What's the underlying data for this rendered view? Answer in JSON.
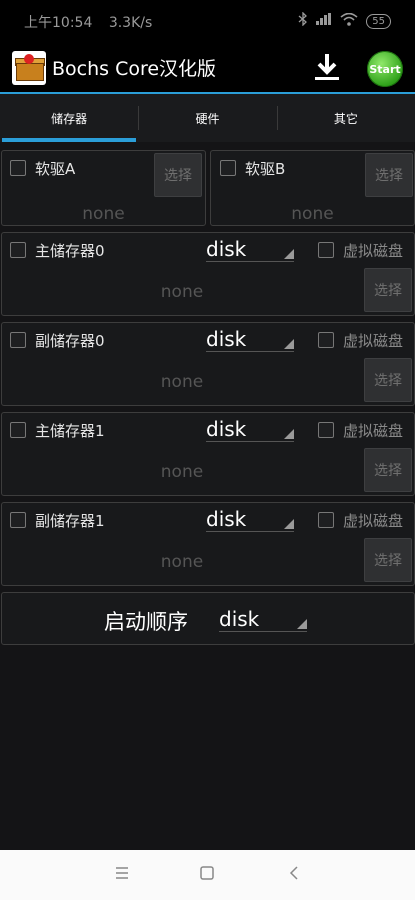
{
  "status": {
    "time": "上午10:54",
    "speed": "3.3K/s",
    "battery": "55"
  },
  "app": {
    "title": "Bochs Core汉化版",
    "start_label": "Start"
  },
  "tabs": [
    {
      "label": "储存器"
    },
    {
      "label": "硬件"
    },
    {
      "label": "其它"
    }
  ],
  "floppy": [
    {
      "label": "软驱A",
      "value": "none",
      "button": "选择"
    },
    {
      "label": "软驱B",
      "value": "none",
      "button": "选择"
    }
  ],
  "drives": [
    {
      "label": "主储存器0",
      "type": "disk",
      "virtual_label": "虚拟磁盘",
      "value": "none",
      "button": "选择"
    },
    {
      "label": "副储存器0",
      "type": "disk",
      "virtual_label": "虚拟磁盘",
      "value": "none",
      "button": "选择"
    },
    {
      "label": "主储存器1",
      "type": "disk",
      "virtual_label": "虚拟磁盘",
      "value": "none",
      "button": "选择"
    },
    {
      "label": "副储存器1",
      "type": "disk",
      "virtual_label": "虚拟磁盘",
      "value": "none",
      "button": "选择"
    }
  ],
  "boot": {
    "label": "启动顺序",
    "value": "disk"
  },
  "colors": {
    "accent": "#2b9ed8",
    "start_green": "#2fa11a"
  }
}
